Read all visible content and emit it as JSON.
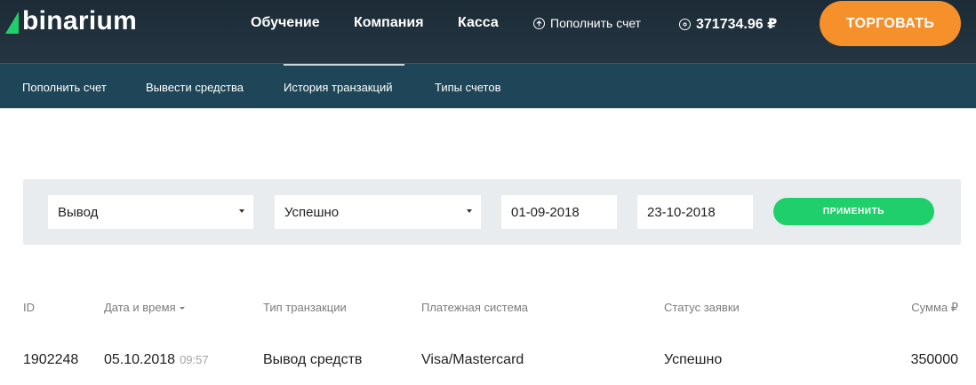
{
  "brand": {
    "name": "binarium",
    "accent": "#1fcf6b",
    "orange": "#f5902b"
  },
  "header": {
    "nav": [
      "Обучение",
      "Компания",
      "Касса"
    ],
    "deposit_label": "Пополнить счет",
    "balance": "371734.96 ₽",
    "trade_button": "ТОРГОВАТЬ"
  },
  "subnav": {
    "items": [
      "Пополнить счет",
      "Вывести средства",
      "История транзакций",
      "Типы счетов"
    ],
    "active": "История транзакций"
  },
  "filters": {
    "type": "Вывод",
    "status": "Успешно",
    "date_from": "01-09-2018",
    "date_to": "23-10-2018",
    "apply_label": "ПРИМЕНИТЬ"
  },
  "table": {
    "columns": [
      "ID",
      "Дата и время",
      "Тип транзакции",
      "Платежная система",
      "Статус заявки",
      "Сумма ₽"
    ],
    "rows": [
      {
        "id": "1902248",
        "date": "05.10.2018",
        "time": "09:57",
        "type": "Вывод средств",
        "system": "Visa/Mastercard",
        "status": "Успешно",
        "amount": "350000"
      }
    ]
  }
}
